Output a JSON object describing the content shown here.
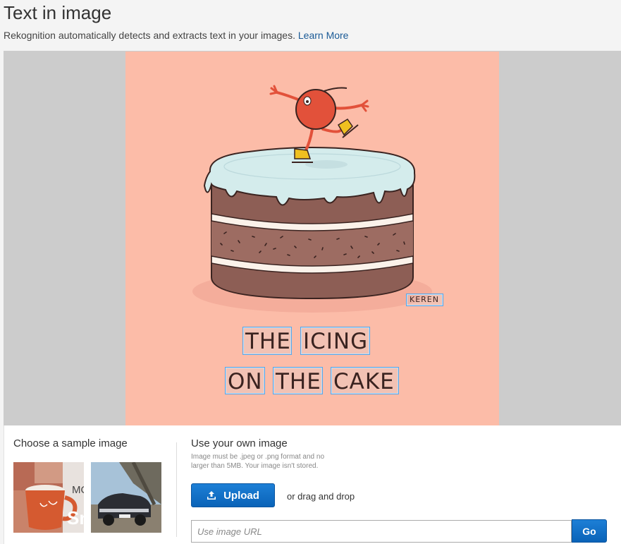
{
  "header": {
    "title": "Text in image",
    "subtitle": "Rekognition automatically detects and extracts text in your images.",
    "learn_more": "Learn More"
  },
  "image": {
    "signature": "KEREN",
    "detected_words": [
      "THE",
      "ICING",
      "ON",
      "THE",
      "CAKE",
      "KEREN"
    ],
    "colors": {
      "background": "#fcbca8",
      "box": "#5aa5e6"
    }
  },
  "samples": {
    "label": "Choose a sample image",
    "items": [
      {
        "name": "mug-sample",
        "text_mo": "MO",
        "text_sn": "Sn"
      },
      {
        "name": "car-sample"
      }
    ]
  },
  "own_image": {
    "label": "Use your own image",
    "hint": "Image must be .jpeg or .png format and no larger than 5MB. Your image isn't stored.",
    "upload_label": "Upload",
    "drag_text": "or drag and drop",
    "url_placeholder": "Use image URL",
    "go_label": "Go"
  }
}
